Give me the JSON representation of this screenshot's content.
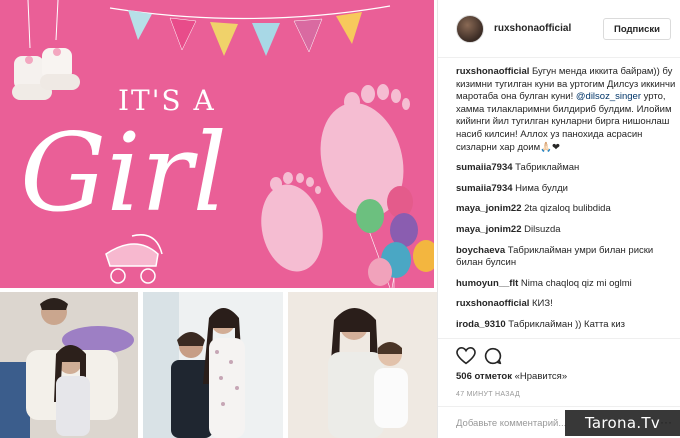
{
  "post": {
    "banner": {
      "line1": "IT'S A",
      "line2": "Girl"
    },
    "photos": [
      {
        "name": "couple-photo"
      },
      {
        "name": "mother-daughter-photo"
      },
      {
        "name": "mother-baby-photo"
      }
    ]
  },
  "header": {
    "username": "ruxshonaofficial",
    "follow_label": "Подписки"
  },
  "caption": {
    "user": "ruxshonaofficial",
    "text_before": " Бугун менда иккита байрам)) бу кизимни тугилган куни ва уртогим Дилсуз иккинчи маротаба она булган куни! ",
    "mention": "@dilsoz_singer",
    "text_after": " урто, хамма тилакларимни билдириб булдим. Илойим кийинги йил тугилган кунларни бирга нишонлаш насиб килсин! Аллох уз панохида асрасин сизларни хар доим🙏🏻❤"
  },
  "comments": [
    {
      "user": "sumaiia7934",
      "text": " Табриклайман"
    },
    {
      "user": "sumaiia7934",
      "text": " Нима булди"
    },
    {
      "user": "maya_jonim22",
      "text": " 2ta qizaloq bulibdida"
    },
    {
      "user": "maya_jonim22",
      "text": " Dilsuzda"
    },
    {
      "user": "boychaeva",
      "text": " Табриклайман умри билан риски билан булсин"
    },
    {
      "user": "humoyun__flt",
      "text": " Nima chaqloq qiz mi oglmi"
    },
    {
      "user": "ruxshonaofficial",
      "text": " КИЗ!"
    },
    {
      "user": "iroda_9310",
      "text": " Табриклайман )) Катта киз"
    }
  ],
  "actions": {
    "likes_count": "506 отметок",
    "likes_suffix": " «Нравится»",
    "timestamp": "47 МИНУТ НАЗАД",
    "comment_placeholder": "Добавьте комментарий...",
    "more_glyph": "···"
  },
  "watermark": "Tarona.Tv",
  "colors": {
    "banner_pink": "#ea5f97",
    "flags": [
      "#e84c8a",
      "#f4b9c9",
      "#7fc8d8",
      "#f0d26a",
      "#b7e0e8",
      "#d96aa1",
      "#f7c95c",
      "#a8d8e6"
    ],
    "balloons": [
      "#6cc07f",
      "#e45b8b",
      "#f3b63f",
      "#4aa7c4",
      "#c9699f",
      "#f1a2bb"
    ]
  },
  "icons": [
    "heart-icon",
    "comment-icon",
    "more-options-icon",
    "booties-icon",
    "footprints-icon",
    "balloons-icon",
    "carriage-icon"
  ]
}
